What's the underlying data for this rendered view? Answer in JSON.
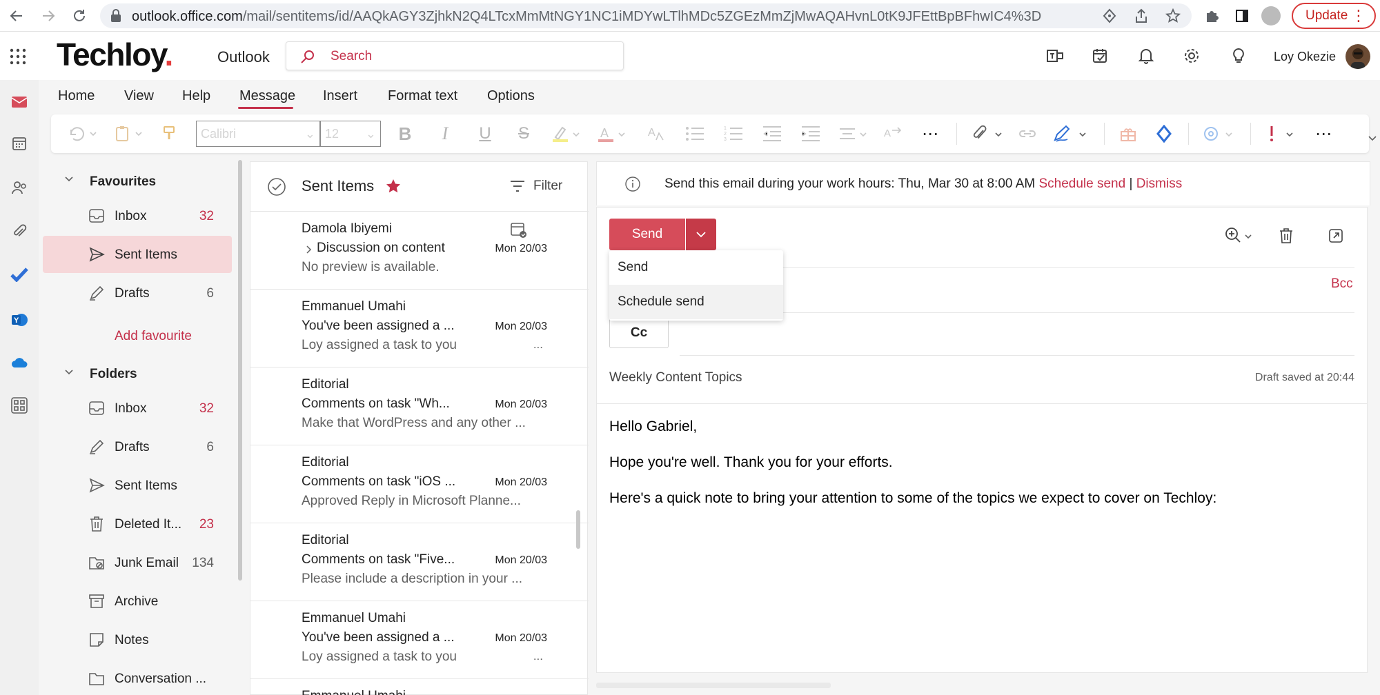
{
  "browser": {
    "url_host": "outlook.office.com",
    "url_path": "/mail/sentitems/id/AAQkAGY3ZjhkN2Q4LTcxMmMtNGY1NC1iMDYwLTlhMDc5ZGEzMmZjMwAQAHvnL0tK9JFEttBpBFhwIC4%3D",
    "update_label": "Update"
  },
  "header": {
    "brand": "Techloy",
    "brand_dot": ".",
    "app_name": "Outlook",
    "search_placeholder": "Search",
    "user_name": "Loy Okezie"
  },
  "ribbon": {
    "tabs": [
      "Home",
      "View",
      "Help",
      "Message",
      "Insert",
      "Format text",
      "Options"
    ],
    "active_tab": "Message",
    "font_name": "Calibri",
    "font_size": "12"
  },
  "folders": {
    "favourites_label": "Favourites",
    "favourites": [
      {
        "label": "Inbox",
        "count": "32",
        "icon": "inbox-icon",
        "red": true
      },
      {
        "label": "Sent Items",
        "count": "",
        "icon": "send-icon",
        "selected": true
      },
      {
        "label": "Drafts",
        "count": "6",
        "icon": "pencil-icon"
      }
    ],
    "add_favourite": "Add favourite",
    "folders_label": "Folders",
    "items": [
      {
        "label": "Inbox",
        "count": "32",
        "icon": "inbox-icon",
        "red": true
      },
      {
        "label": "Drafts",
        "count": "6",
        "icon": "pencil-icon"
      },
      {
        "label": "Sent Items",
        "count": "",
        "icon": "send-icon"
      },
      {
        "label": "Deleted It...",
        "count": "23",
        "icon": "trash-icon",
        "red": true
      },
      {
        "label": "Junk Email",
        "count": "134",
        "icon": "junk-icon"
      },
      {
        "label": "Archive",
        "count": "",
        "icon": "archive-icon"
      },
      {
        "label": "Notes",
        "count": "",
        "icon": "note-icon"
      },
      {
        "label": "Conversation ...",
        "count": "",
        "icon": "folder-icon"
      }
    ]
  },
  "message_list": {
    "title": "Sent Items",
    "filter_label": "Filter",
    "messages": [
      {
        "sender": "Damola Ibiyemi",
        "subject": "Discussion on content",
        "date": "Mon 20/03",
        "preview": "No preview is available.",
        "ellipsis": "",
        "thread": true
      },
      {
        "sender": "Emmanuel Umahi",
        "subject": "You've been assigned a ...",
        "date": "Mon 20/03",
        "preview": "Loy assigned a task to you",
        "ellipsis": "..."
      },
      {
        "sender": "Editorial",
        "subject": "Comments on task \"Wh...",
        "date": "Mon 20/03",
        "preview": "Make that WordPress and any other ...",
        "ellipsis": ""
      },
      {
        "sender": "Editorial",
        "subject": "Comments on task \"iOS ...",
        "date": "Mon 20/03",
        "preview": "Approved Reply in Microsoft Planne...",
        "ellipsis": ""
      },
      {
        "sender": "Editorial",
        "subject": "Comments on task \"Five...",
        "date": "Mon 20/03",
        "preview": "Please include a description in your ...",
        "ellipsis": ""
      },
      {
        "sender": "Emmanuel Umahi",
        "subject": "You've been assigned a ...",
        "date": "Mon 20/03",
        "preview": "Loy assigned a task to you",
        "ellipsis": "..."
      },
      {
        "sender": "Emmanuel Umahi",
        "subject": "",
        "date": "",
        "preview": "",
        "ellipsis": ""
      }
    ]
  },
  "compose": {
    "info_text": "Send this email during your work hours: Thu, Mar 30 at 8:00 AM",
    "schedule_link": "Schedule send",
    "separator": "|",
    "dismiss_link": "Dismiss",
    "send_label": "Send",
    "send_menu": [
      "Send",
      "Schedule send"
    ],
    "bcc_label": "Bcc",
    "cc_label": "Cc",
    "subject": "Weekly Content Topics",
    "draft_status": "Draft saved at 20:44",
    "body": [
      "Hello Gabriel,",
      "Hope you're well. Thank you for your efforts.",
      "Here's a quick note to bring your attention to some of the topics we expect to cover on Techloy:"
    ]
  },
  "colors": {
    "accent": "#c4314b",
    "send_button": "#d64c5a",
    "selected_folder": "#f6d7d9"
  }
}
